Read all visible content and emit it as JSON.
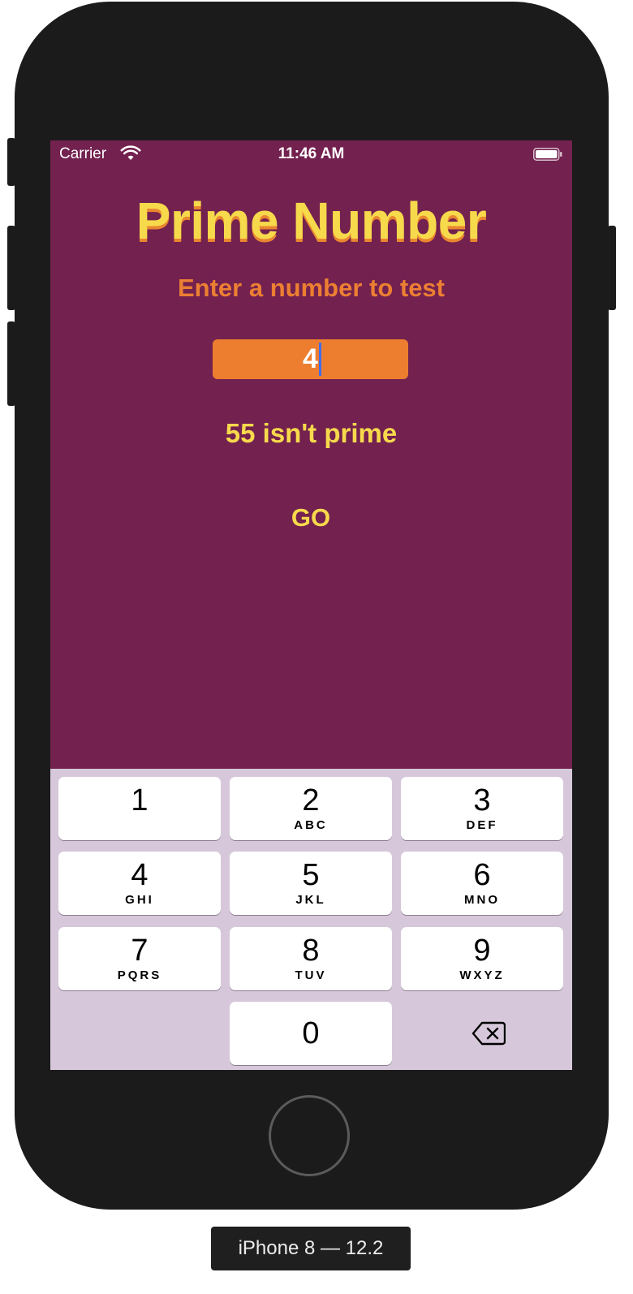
{
  "status_bar": {
    "carrier": "Carrier",
    "time": "11:46 AM",
    "wifi_icon": "wifi-icon",
    "battery_icon": "battery-icon"
  },
  "app": {
    "title": "Prime Number",
    "subtitle": "Enter a number to test",
    "number_field_value": "4",
    "result_text": "55 isn't prime",
    "go_button_label": "GO"
  },
  "keyboard": {
    "keys": [
      {
        "digit": "1",
        "letters": ""
      },
      {
        "digit": "2",
        "letters": "ABC"
      },
      {
        "digit": "3",
        "letters": "DEF"
      },
      {
        "digit": "4",
        "letters": "GHI"
      },
      {
        "digit": "5",
        "letters": "JKL"
      },
      {
        "digit": "6",
        "letters": "MNO"
      },
      {
        "digit": "7",
        "letters": "PQRS"
      },
      {
        "digit": "8",
        "letters": "TUV"
      },
      {
        "digit": "9",
        "letters": "WXYZ"
      },
      {
        "digit": "0",
        "letters": ""
      }
    ],
    "delete_icon": "backspace-icon"
  },
  "device_label": "iPhone 8 — 12.2",
  "colors": {
    "background": "#73214f",
    "title": "#f7d94c",
    "title_shadow": "#e9862f",
    "subtitle": "#ec7f32",
    "field": "#ed7e30",
    "keyboard": "#d6c8da"
  }
}
